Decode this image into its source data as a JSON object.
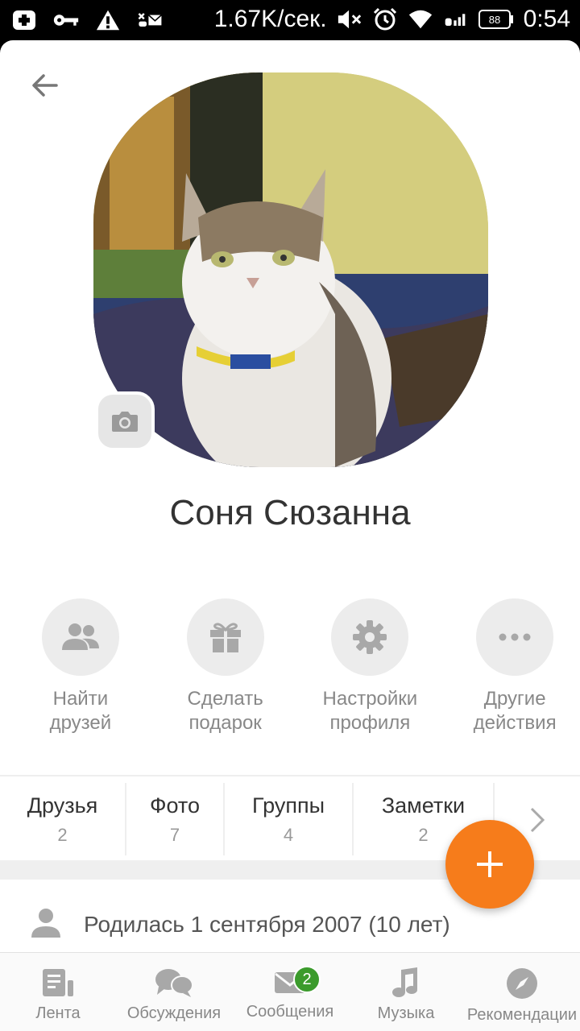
{
  "status_bar": {
    "net_speed": "1.67K/сек.",
    "battery": "88",
    "time": "0:54",
    "icons": [
      "plus-box-icon",
      "key-icon",
      "warning-icon",
      "missed-call-icon",
      "mail-icon",
      "mute-icon",
      "alarm-icon",
      "wifi-icon",
      "signal-icon",
      "battery-icon"
    ]
  },
  "profile": {
    "name": "Соня Сюзанна",
    "avatar_alt": "cat photo"
  },
  "actions": [
    {
      "label": "Найти\nдрузей",
      "icon": "people-icon"
    },
    {
      "label": "Сделать\nподарок",
      "icon": "gift-icon"
    },
    {
      "label": "Настройки\nпрофиля",
      "icon": "gear-icon"
    },
    {
      "label": "Другие\nдействия",
      "icon": "more-icon"
    }
  ],
  "tabs": [
    {
      "label": "Друзья",
      "count": "2"
    },
    {
      "label": "Фото",
      "count": "7"
    },
    {
      "label": "Группы",
      "count": "4"
    },
    {
      "label": "Заметки",
      "count": "2"
    }
  ],
  "info": {
    "birth": "Родилась 1 сентября 2007 (10 лет)"
  },
  "bottom_nav": [
    {
      "label": "Лента",
      "icon": "feed-icon"
    },
    {
      "label": "Обсуждения",
      "icon": "discussions-icon"
    },
    {
      "label": "Сообщения",
      "icon": "mail-icon",
      "badge": "2"
    },
    {
      "label": "Музыка",
      "icon": "music-icon"
    },
    {
      "label": "Рекомендации",
      "icon": "compass-icon"
    }
  ],
  "colors": {
    "accent": "#f67c1b",
    "badge": "#3b9b2c",
    "icon_gray": "#a8a8a8"
  }
}
